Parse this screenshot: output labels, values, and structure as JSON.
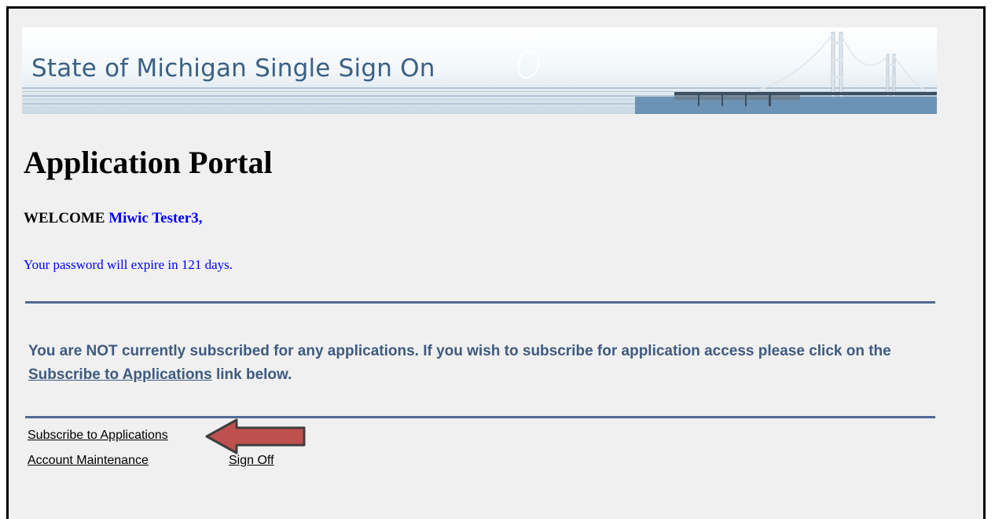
{
  "banner": {
    "title": "State of Michigan Single Sign On"
  },
  "page_title": "Application Portal",
  "welcome": {
    "label": "WELCOME",
    "user_name": "Miwic Tester3,"
  },
  "password_notice": "Your password will expire in 121 days.",
  "subscription_notice": {
    "text_before": "You are NOT currently subscribed for any applications. If you wish to subscribe for application access please click on the ",
    "link_text": "Subscribe to Applications",
    "text_after": " link below."
  },
  "nav_links": {
    "subscribe": "Subscribe to Applications",
    "account_maintenance": "Account Maintenance",
    "sign_off": "Sign Off"
  },
  "colors": {
    "banner_text": "#3a6084",
    "notice_text": "#3e5b80",
    "welcome_name": "#0000ff",
    "rule": "#4f6a94",
    "arrow_fill": "#c0504d"
  }
}
